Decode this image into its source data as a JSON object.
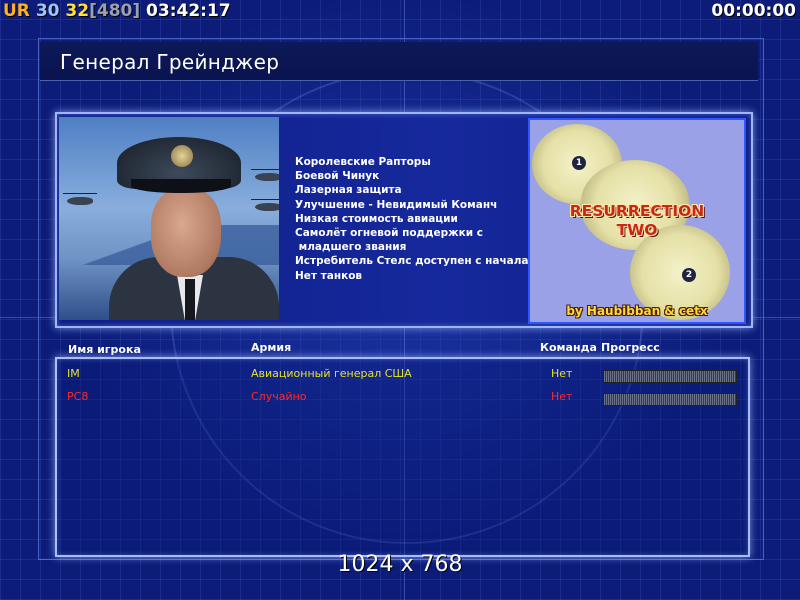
{
  "hud": {
    "ur": "UR",
    "fps": "30",
    "frame": "32",
    "limit": "[480]",
    "clock": "03:42:17",
    "timer": "00:00:00"
  },
  "screen_title": "Генерал Грейнджер",
  "general": {
    "features": [
      "Королевские Рапторы",
      "Боевой Чинук",
      "Лазерная защита",
      "Улучшение - Невидимый Команч",
      "Низкая стоимость авиации",
      "Самолёт огневой поддержки с",
      " младшего звания",
      "Истребитель Стелс доступен с начала",
      "Нет танков"
    ]
  },
  "map": {
    "title_line1": "RESURRECTION",
    "title_line2": "TWO",
    "credit": "by Haubibban & cetx",
    "start_positions": [
      "1",
      "2"
    ]
  },
  "table": {
    "headers": {
      "player": "Имя игрока",
      "army": "Армия",
      "team": "Команда",
      "progress": "Прогресс"
    },
    "rows": [
      {
        "name": "IM",
        "army": "Авиационный генерал США",
        "team": "Нет",
        "color": "#e6e22a"
      },
      {
        "name": "PC8",
        "army": "Случайно",
        "team": "Нет",
        "color": "#ff2a2a"
      }
    ]
  },
  "resolution": "1024 x 768",
  "colors": {
    "background": "#0c1c78",
    "panel_border": "#9fb6ff",
    "hud_ur": "#ffb020",
    "hud_frame": "#ffe040"
  }
}
